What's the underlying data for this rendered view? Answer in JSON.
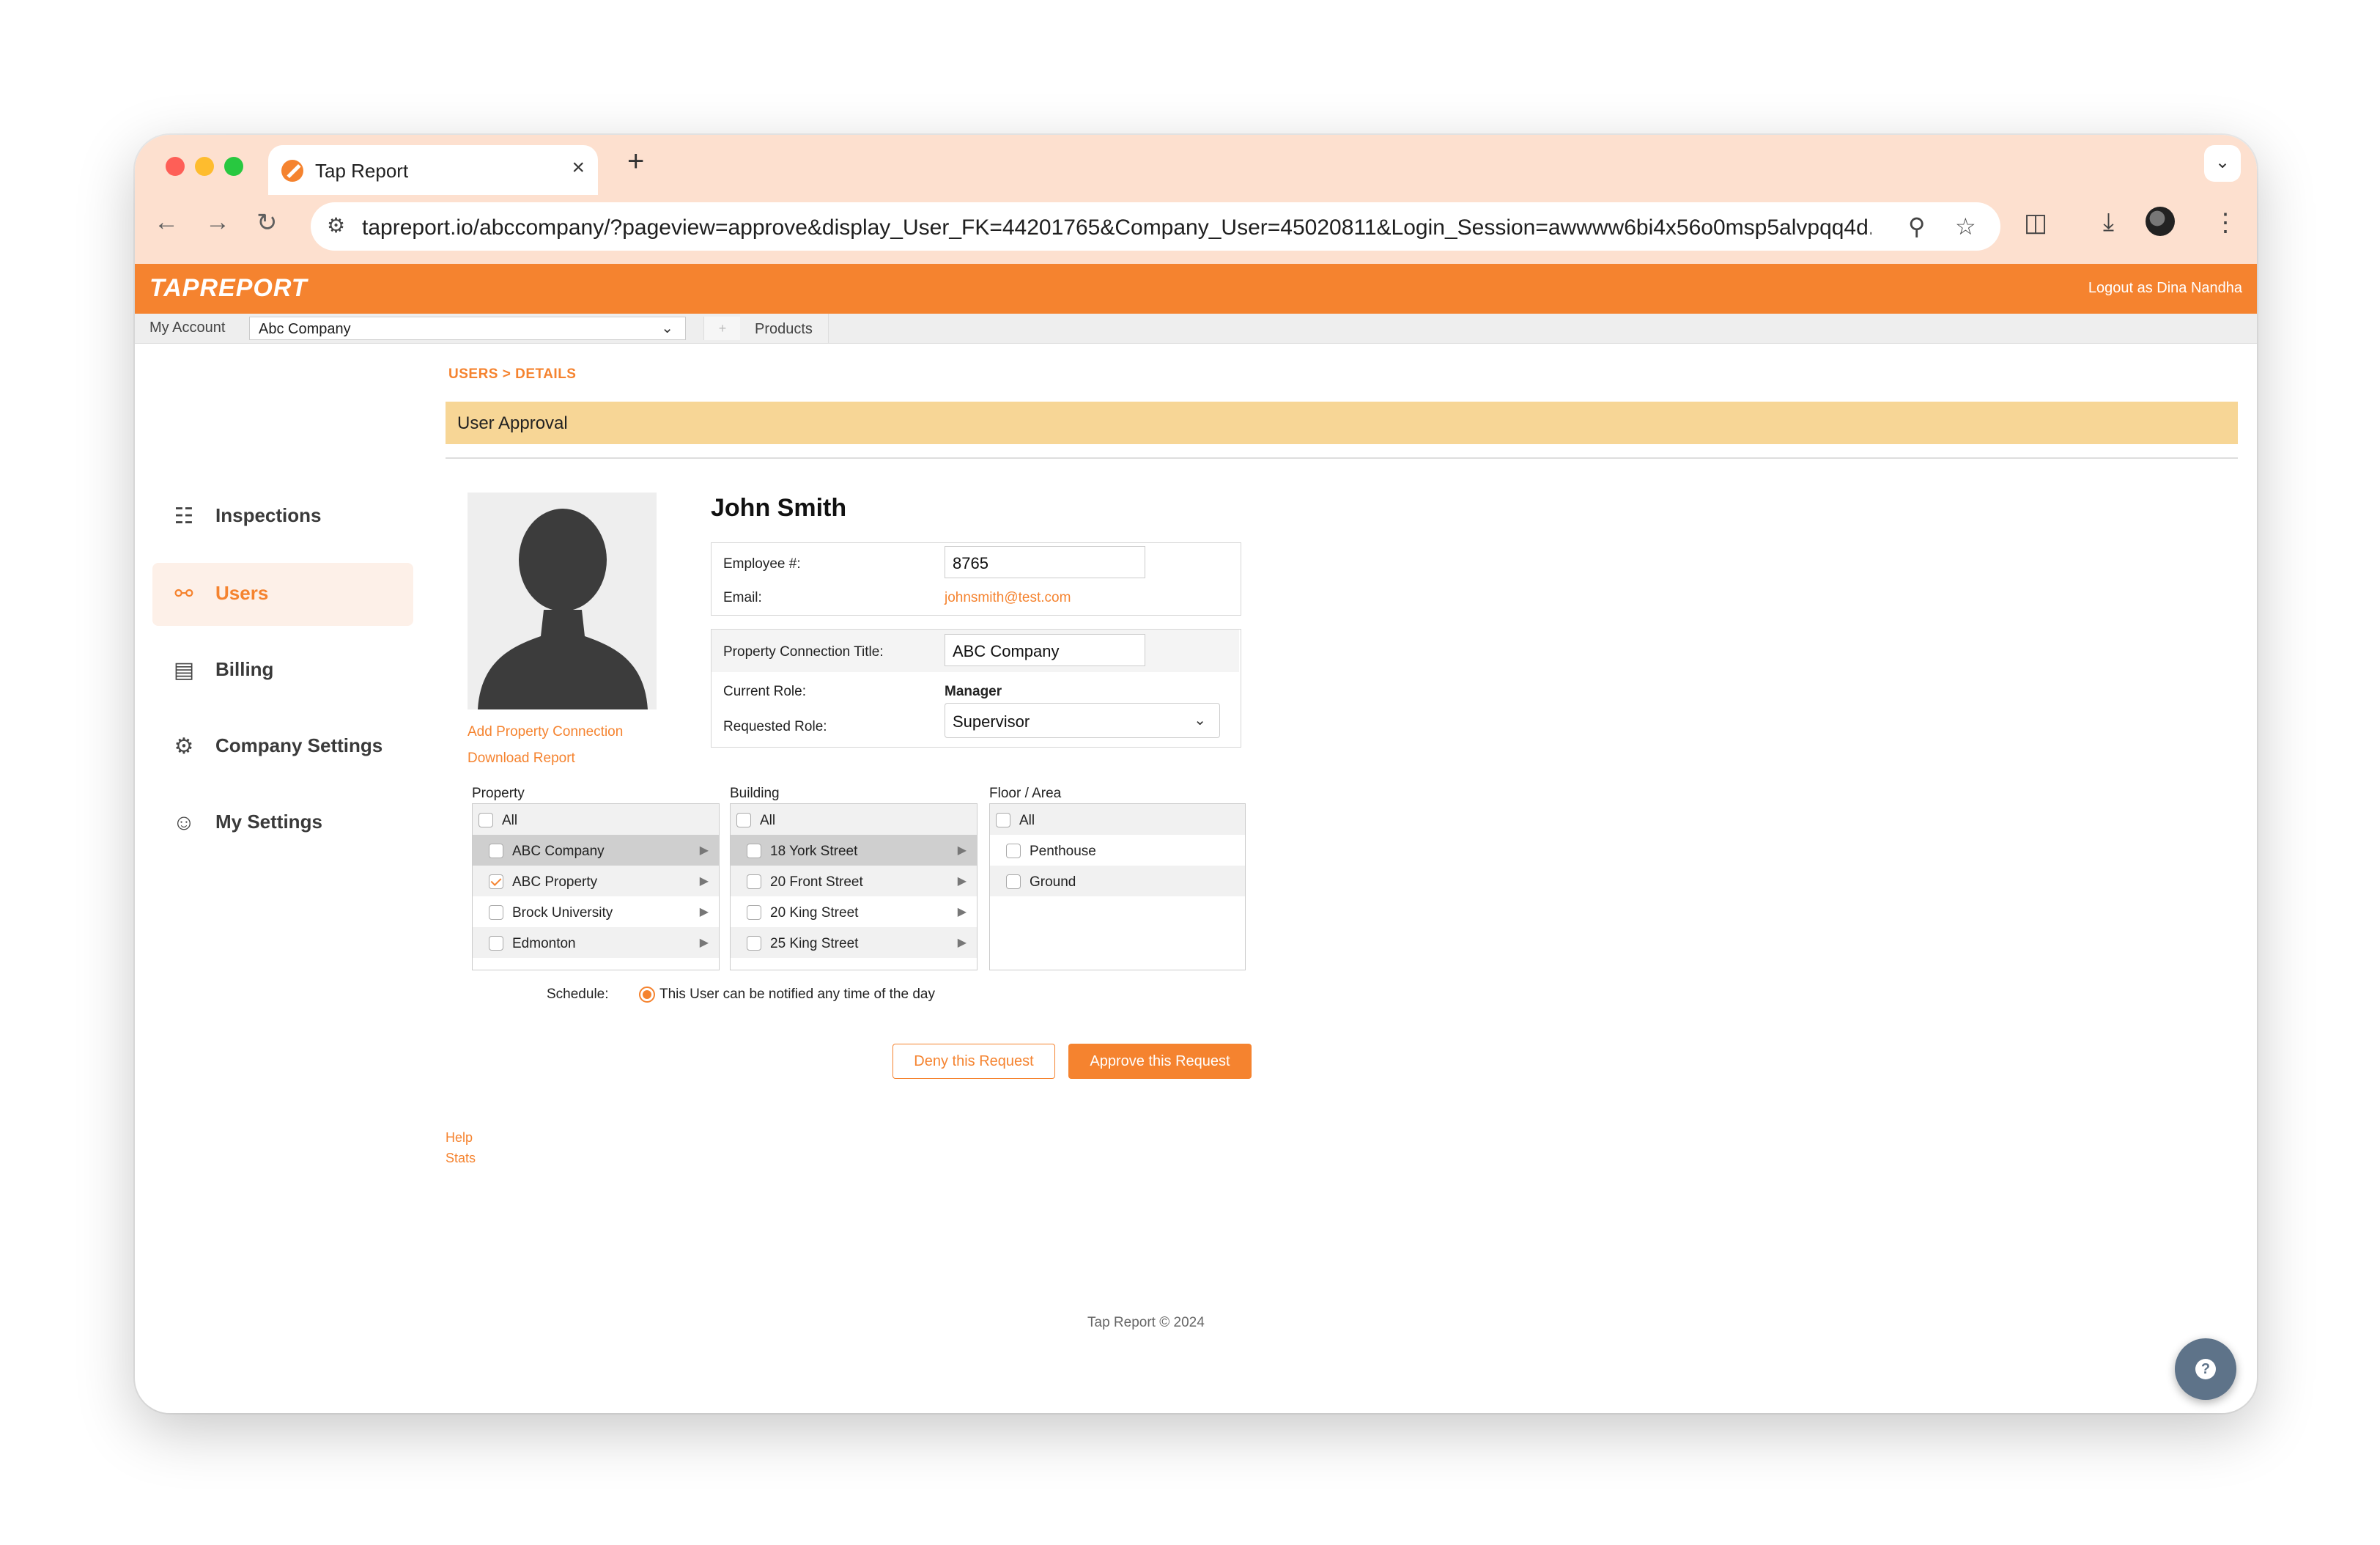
{
  "browser": {
    "tab_title": "Tap Report",
    "tab_close": "×",
    "new_tab": "+",
    "url": "tapreport.io/abccompany/?pageview=approve&display_User_FK=44201765&Company_User=45020811&Login_Session=awwww6bi4x56o0msp5alvpqq4d..."
  },
  "header": {
    "logo": "TAPREPORT",
    "logout": "Logout as Dina Nandha"
  },
  "subbar": {
    "my_account": "My Account",
    "company": "Abc Company",
    "products": "Products"
  },
  "sidebar": {
    "items": [
      {
        "label": "Inspections",
        "icon": "inspections-icon"
      },
      {
        "label": "Users",
        "icon": "users-icon"
      },
      {
        "label": "Billing",
        "icon": "billing-icon"
      },
      {
        "label": "Company Settings",
        "icon": "gear-icon"
      },
      {
        "label": "My Settings",
        "icon": "user-circle-icon"
      }
    ],
    "active": "Users"
  },
  "main": {
    "breadcrumb": "USERS > DETAILS",
    "banner": "User Approval",
    "links": {
      "add_property": "Add Property Connection",
      "download_report": "Download Report"
    },
    "user": {
      "name": "John Smith",
      "employee_label": "Employee #:",
      "employee_value": "8765",
      "email_label": "Email:",
      "email_value": "johnsmith@test.com",
      "property_title_label": "Property Connection Title:",
      "property_title_value": "ABC Company",
      "current_role_label": "Current Role:",
      "current_role_value": "Manager",
      "requested_role_label": "Requested Role:",
      "requested_role_value": "Supervisor"
    },
    "columns": {
      "property": {
        "header": "Property",
        "items": [
          "All",
          "ABC Company",
          "ABC Property",
          "Brock University",
          "Edmonton"
        ]
      },
      "building": {
        "header": "Building",
        "items": [
          "All",
          "18 York Street",
          "20 Front Street",
          "20 King Street",
          "25 King Street"
        ]
      },
      "floor": {
        "header": "Floor / Area",
        "items": [
          "All",
          "Penthouse",
          "Ground"
        ]
      }
    },
    "schedule": {
      "label": "Schedule:",
      "option": "This User can be notified any time of the day"
    },
    "buttons": {
      "deny": "Deny this Request",
      "approve": "Approve this Request"
    },
    "footer_links": {
      "help": "Help",
      "stats": "Stats"
    },
    "copyright": "Tap Report © 2024"
  },
  "colors": {
    "brand": "#f5832f",
    "banner": "#f7d696",
    "chrome": "#fde0cf",
    "help_bubble": "#5e7389"
  }
}
